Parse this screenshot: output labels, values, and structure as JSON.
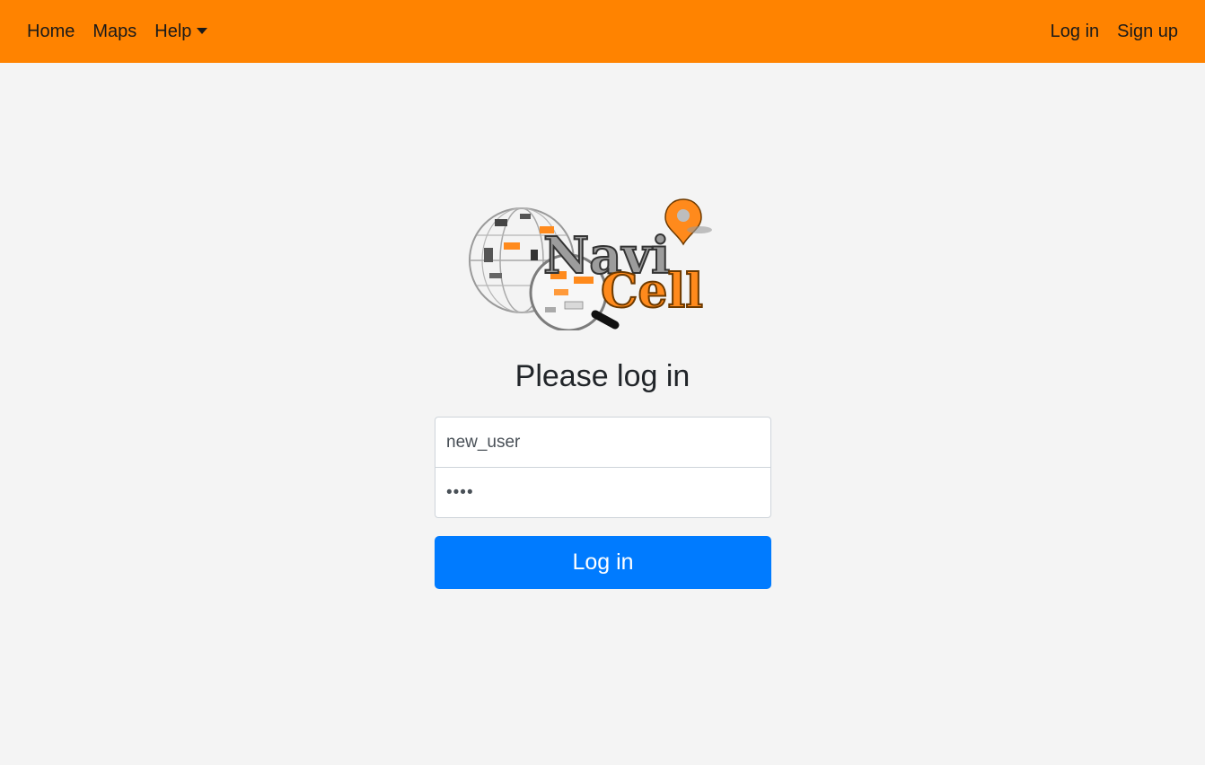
{
  "navbar": {
    "left_items": [
      {
        "label": "Home"
      },
      {
        "label": "Maps"
      },
      {
        "label": "Help"
      }
    ],
    "right_items": [
      {
        "label": "Log in"
      },
      {
        "label": "Sign up"
      }
    ],
    "background_color": "#ff8300"
  },
  "logo": {
    "text_top": "Navi",
    "text_bottom": "Cell"
  },
  "login": {
    "title": "Please log in",
    "username_value": "new_user",
    "password_value": "1234",
    "submit_label": "Log in",
    "button_color": "#007bff"
  }
}
